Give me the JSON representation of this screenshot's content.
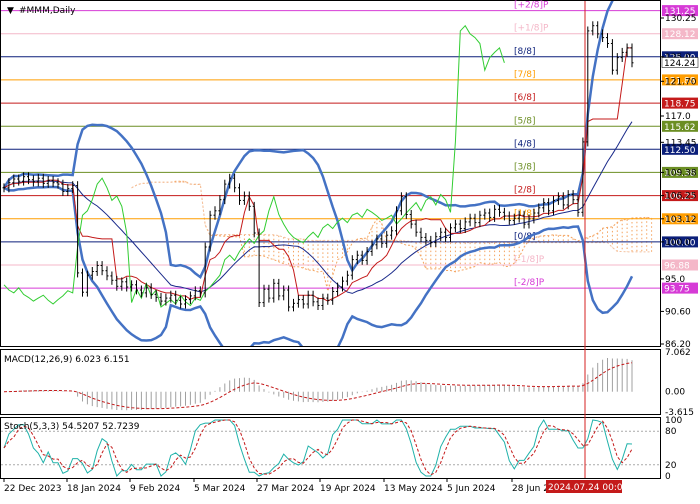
{
  "chart_data": [
    {
      "type": "line",
      "title": "#MMM,Daily",
      "y_axis_ticks": [
        130.25,
        125.0,
        121.7,
        117.0,
        113.45,
        109.38,
        106.25,
        103.12,
        100.0,
        95.0,
        90.6,
        86.2
      ],
      "ylim": [
        86.2,
        131.8
      ],
      "x_tick_labels": [
        "22 Dec 2023",
        "18 Jan 2024",
        "9 Feb 2024",
        "5 Mar 2024",
        "27 Mar 2024",
        "19 Apr 2024",
        "13 May 2024",
        "5 Jun 2024",
        "28 Jun 2024"
      ],
      "cursor_label": "2024.07.24 00:00",
      "current_price": "124.24",
      "murray_levels": [
        {
          "label": "[+2/8]P",
          "value": 131.25,
          "value_label": "131.25",
          "color": "#d63bd6"
        },
        {
          "label": "[+1/8]P",
          "value": 128.12,
          "value_label": "128.12",
          "color": "#f4b7c8"
        },
        {
          "label": "[8/8]",
          "value": 125.0,
          "value_label": "125.00",
          "color": "#0b1f7a"
        },
        {
          "label": "[7/8]",
          "value": 121.88,
          "value_label": "121.88",
          "color": "#ff9d00"
        },
        {
          "label": "[6/8]",
          "value": 118.75,
          "value_label": "118.75",
          "color": "#c41a1a"
        },
        {
          "label": "[5/8]",
          "value": 115.62,
          "value_label": "115.62",
          "color": "#6b8e23"
        },
        {
          "label": "[4/8]",
          "value": 112.5,
          "value_label": "112.50",
          "color": "#0b1f7a"
        },
        {
          "label": "[3/8]",
          "value": 109.38,
          "value_label": "109.38",
          "color": "#6b8e23"
        },
        {
          "label": "[2/8]",
          "value": 106.25,
          "value_label": "106.25",
          "color": "#c41a1a"
        },
        {
          "label": "[1/8]",
          "value": 103.12,
          "value_label": "103.12",
          "color": "#ff9d00"
        },
        {
          "label": "[0/8]",
          "value": 100.0,
          "value_label": "100.00",
          "color": "#0b1f7a"
        },
        {
          "label": "[-1/8]P",
          "value": 96.88,
          "value_label": "96.88",
          "color": "#f4b7c8"
        },
        {
          "label": "[-2/8]P",
          "value": 93.75,
          "value_label": "93.75",
          "color": "#d63bd6"
        }
      ],
      "series": [
        {
          "name": "price",
          "color": "#000000",
          "values": [
            107.3,
            108.0,
            108.5,
            108.2,
            108.8,
            108.4,
            108.1,
            108.6,
            107.9,
            108.3,
            108.0,
            107.8,
            106.8,
            107.2,
            107.6,
            95.8,
            93.2,
            95.5,
            96.0,
            96.8,
            96.1,
            95.4,
            94.8,
            94.0,
            94.6,
            93.9,
            94.2,
            93.5,
            93.1,
            93.8,
            92.9,
            92.5,
            92.0,
            92.4,
            92.8,
            92.1,
            91.6,
            92.2,
            92.7,
            93.4,
            93.1,
            99.3,
            103.6,
            104.2,
            105.7,
            107.8,
            108.6,
            107.3,
            105.6,
            106.2,
            104.8,
            101.2,
            91.8,
            93.6,
            92.4,
            94.4,
            92.7,
            93.5,
            91.2,
            91.7,
            92.2,
            91.6,
            92.8,
            91.9,
            91.4,
            92.4,
            92.1,
            93.3,
            93.9,
            94.7,
            95.5,
            97.6,
            98.2,
            97.5,
            98.7,
            99.6,
            100.4,
            99.8,
            100.9,
            101.5,
            104.2,
            106.1,
            103.7,
            102.4,
            101.3,
            100.6,
            100.2,
            99.9,
            100.7,
            101.3,
            100.6,
            101.9,
            102.4,
            101.8,
            102.7,
            103.2,
            102.6,
            103.6,
            103.9,
            103.3,
            104.4,
            104.0,
            103.5,
            102.9,
            103.2,
            103.6,
            102.4,
            103.1,
            103.9,
            104.6,
            105.3,
            104.2,
            105.6,
            106.1,
            105.0,
            106.4,
            105.7,
            104.0,
            113.5,
            128.5,
            129.2,
            128.1,
            127.6,
            126.8,
            123.2,
            124.9,
            125.6,
            126.2,
            124.2
          ]
        },
        {
          "name": "ichimoku_span_a",
          "color": "#f4a460",
          "values": []
        },
        {
          "name": "bollinger_upper",
          "color": "#4472c4",
          "values": []
        }
      ]
    },
    {
      "type": "bar",
      "title": "MACD(12,26,9) 6.023 6.151",
      "y_axis_ticks": [
        "7.062",
        "0.00",
        "-3.615"
      ],
      "ylim": [
        -3.615,
        7.062
      ],
      "series": [
        {
          "name": "MACD",
          "color": "#9a9a9a",
          "values": []
        },
        {
          "name": "signal",
          "color": "#c41a1a",
          "values": []
        }
      ]
    },
    {
      "type": "line",
      "title": "Stoch(5,3,3) 54.5207 52.7239",
      "y_axis_ticks": [
        "100",
        "80",
        "20",
        "0"
      ],
      "ylim": [
        0,
        100
      ],
      "series": [
        {
          "name": "main",
          "color": "#20b2aa",
          "values": []
        },
        {
          "name": "signal",
          "color": "#c41a1a",
          "values": []
        }
      ]
    }
  ]
}
